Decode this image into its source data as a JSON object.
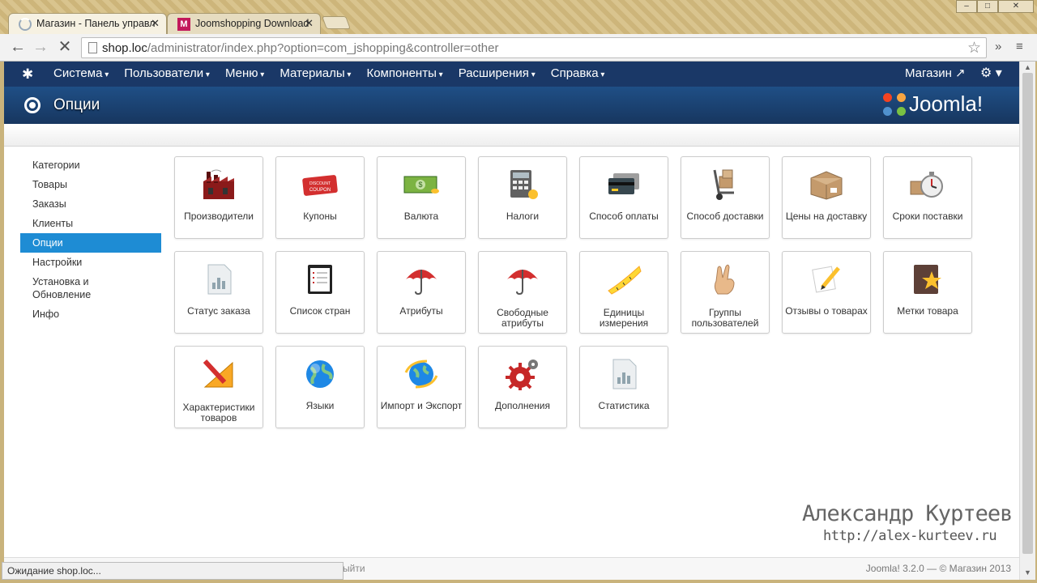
{
  "browser": {
    "tabs": [
      {
        "title": "Магазин - Панель управл",
        "active": true
      },
      {
        "title": "Joomshopping Download",
        "active": false
      }
    ],
    "tab_close": "✕",
    "url_host": "shop.loc",
    "url_path": "/administrator/index.php?option=com_jshopping&controller=other",
    "status_text": "Ожидание shop.loc..."
  },
  "topnav": {
    "items": [
      "Система",
      "Пользователи",
      "Меню",
      "Материалы",
      "Компоненты",
      "Расширения",
      "Справка"
    ],
    "shop_link": "Магазин",
    "shop_icon": "↗",
    "gear_label": "⚙ ▾"
  },
  "header": {
    "title": "Опции",
    "brand": "Joomla!"
  },
  "sidebar": {
    "items": [
      {
        "label": "Категории"
      },
      {
        "label": "Товары"
      },
      {
        "label": "Заказы"
      },
      {
        "label": "Клиенты"
      },
      {
        "label": "Опции",
        "active": true
      },
      {
        "label": "Настройки"
      },
      {
        "label": "Установка и Обновление"
      },
      {
        "label": "Инфо"
      }
    ]
  },
  "tiles": [
    {
      "label": "Производители",
      "icon": "factory-icon"
    },
    {
      "label": "Купоны",
      "icon": "coupon-icon"
    },
    {
      "label": "Валюта",
      "icon": "money-icon"
    },
    {
      "label": "Налоги",
      "icon": "calculator-icon"
    },
    {
      "label": "Способ оплаты",
      "icon": "credit-card-icon"
    },
    {
      "label": "Способ доставки",
      "icon": "hand-truck-icon"
    },
    {
      "label": "Цены на доставку",
      "icon": "box-icon"
    },
    {
      "label": "Сроки поставки",
      "icon": "stopwatch-icon"
    },
    {
      "label": "Статус заказа",
      "icon": "report-icon"
    },
    {
      "label": "Список стран",
      "icon": "clipboard-icon"
    },
    {
      "label": "Атрибуты",
      "icon": "umbrella-icon"
    },
    {
      "label": "Свободные атрибуты",
      "icon": "umbrella-icon"
    },
    {
      "label": "Единицы измерения",
      "icon": "measuring-tape-icon"
    },
    {
      "label": "Группы пользователей",
      "icon": "hand-icon"
    },
    {
      "label": "Отзывы о товарах",
      "icon": "note-pencil-icon"
    },
    {
      "label": "Метки товара",
      "icon": "star-book-icon"
    },
    {
      "label": "Характеристики товаров",
      "icon": "ruler-pencil-icon"
    },
    {
      "label": "Языки",
      "icon": "globe-icon"
    },
    {
      "label": "Импорт и Экспорт",
      "icon": "globe-arrows-icon"
    },
    {
      "label": "Дополнения",
      "icon": "gears-icon"
    },
    {
      "label": "Статистика",
      "icon": "report-icon"
    }
  ],
  "watermark": {
    "name": "Александр Куртеев",
    "site": "http://alex-kurteev.ru"
  },
  "footer": {
    "version_text": "Joomla! 3.2.0  —  © Магазин 2013",
    "partial_link": "ыйти"
  },
  "colors": {
    "topnav": "#1a3867",
    "active_sidebar": "#1e8cd4"
  }
}
